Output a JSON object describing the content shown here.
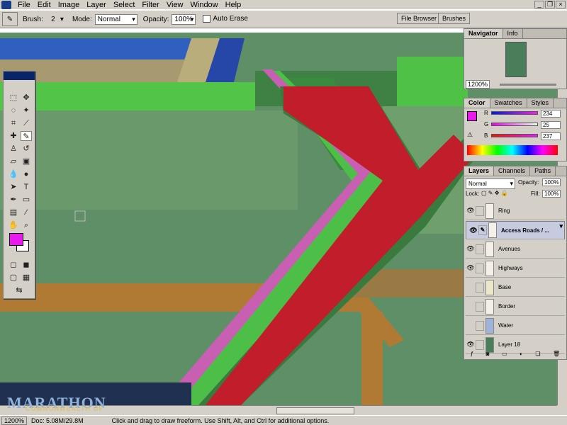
{
  "menu": {
    "items": [
      "File",
      "Edit",
      "Image",
      "Layer",
      "Select",
      "Filter",
      "View",
      "Window",
      "Help"
    ]
  },
  "options": {
    "brush_label": "Brush:",
    "brush_size": "2",
    "mode_label": "Mode:",
    "mode_value": "Normal",
    "opacity_label": "Opacity:",
    "opacity_value": "100%",
    "auto_erase": "Auto Erase"
  },
  "wells": {
    "file_browser": "File Browser",
    "brushes": "Brushes"
  },
  "navigator": {
    "tabs": [
      "Navigator",
      "Info"
    ],
    "zoom": "1200%"
  },
  "color": {
    "tabs": [
      "Color",
      "Swatches",
      "Styles"
    ],
    "r_label": "R",
    "g_label": "G",
    "b_label": "B",
    "r": "234",
    "g": "25",
    "b": "237",
    "foreground": "#ea19ed"
  },
  "layers": {
    "tabs": [
      "Layers",
      "Channels",
      "Paths"
    ],
    "blend": "Normal",
    "opacity_label": "Opacity:",
    "opacity": "100%",
    "lock_label": "Lock:",
    "fill_label": "Fill:",
    "fill": "100%",
    "rows": [
      {
        "name": "Ring",
        "visible": true
      },
      {
        "name": "Access Roads / ...",
        "visible": true,
        "selected": true
      },
      {
        "name": "Avenues",
        "visible": true
      },
      {
        "name": "Highways",
        "visible": true
      },
      {
        "name": "Base",
        "visible": false
      },
      {
        "name": "Border",
        "visible": false
      },
      {
        "name": "Water",
        "visible": false
      },
      {
        "name": "Layer 18",
        "visible": true
      }
    ]
  },
  "status": {
    "zoom": "1200%",
    "doc": "Doc: 5.08M/29.8M",
    "hint": "Click and drag to draw freeform. Use Shift, Alt, and Ctrl for additional options."
  },
  "logo": {
    "title": "MARATHON",
    "subtitle": "COMMONWEALTH OF"
  }
}
